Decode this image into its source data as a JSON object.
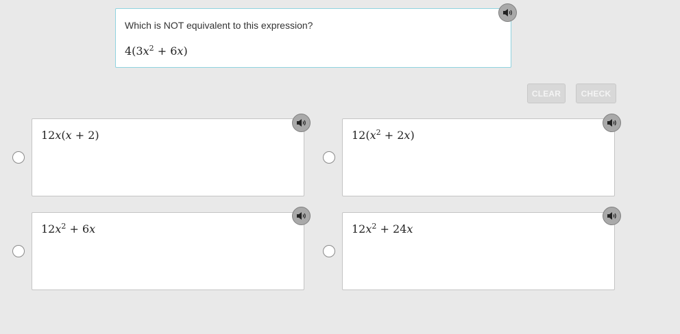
{
  "question": {
    "prompt": "Which is NOT equivalent to this expression?",
    "expression": {
      "a": "4(3",
      "x": "x",
      "exp": "2",
      "b": " + 6",
      "c": ")"
    }
  },
  "icons": {
    "audio": "speaker-icon"
  },
  "toolbar": {
    "clear_label": "CLEAR",
    "check_label": "CHECK"
  },
  "options": [
    {
      "t1": "12",
      "v1": "x",
      "t2": "(",
      "v2": "x",
      "t3": " + 2)"
    },
    {
      "t1": "12(",
      "v1": "x",
      "sup": "2",
      "t2": " + 2",
      "v2": "x",
      "t3": ")"
    },
    {
      "t1": "12",
      "v1": "x",
      "sup": "2",
      "t2": " + 6",
      "v2": "x"
    },
    {
      "t1": "12",
      "v1": "x",
      "sup": "2",
      "t2": " + 24",
      "v2": "x"
    }
  ]
}
